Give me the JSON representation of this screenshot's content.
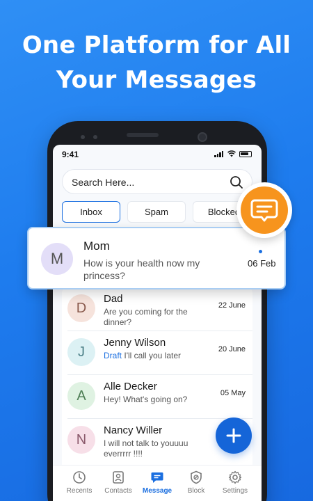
{
  "headline": {
    "line1": "One Platform for All",
    "line2": "Your Messages"
  },
  "status_bar": {
    "time": "9:41"
  },
  "search": {
    "placeholder": "Search Here..."
  },
  "tabs": [
    {
      "label": "Inbox",
      "active": true
    },
    {
      "label": "Spam",
      "active": false
    },
    {
      "label": "Blocked",
      "active": false
    }
  ],
  "highlighted_message": {
    "initial": "M",
    "name": "Mom",
    "preview": "How is your health now my princess?",
    "date": "06 Feb",
    "unread": true
  },
  "messages": [
    {
      "initial": "D",
      "name": "Dad",
      "draft_label": "",
      "preview": "Are you coming for the dinner?",
      "date": "22 June",
      "avatar_bg": "#f6e3dc"
    },
    {
      "initial": "J",
      "name": "Jenny Wilson",
      "draft_label": "Draft",
      "preview": "I'll call you later",
      "date": "20 June",
      "avatar_bg": "#dcf1f4"
    },
    {
      "initial": "A",
      "name": "Alle Decker",
      "draft_label": "",
      "preview": "Hey! What's going on?",
      "date": "05 May",
      "avatar_bg": "#dff2e2"
    },
    {
      "initial": "N",
      "name": "Nancy Willer",
      "draft_label": "",
      "preview": "I will not talk to youuuu everrrrr !!!!",
      "date": "",
      "avatar_bg": "#f7dfe8"
    }
  ],
  "bottom_nav": [
    {
      "label": "Recents",
      "icon": "clock-icon",
      "active": false
    },
    {
      "label": "Contacts",
      "icon": "contacts-icon",
      "active": false
    },
    {
      "label": "Message",
      "icon": "message-icon",
      "active": true
    },
    {
      "label": "Block",
      "icon": "shield-block-icon",
      "active": false
    },
    {
      "label": "Settings",
      "icon": "gear-icon",
      "active": false
    }
  ],
  "colors": {
    "accent": "#1b6fe0",
    "badge": "#f7941d",
    "background": "#1e7cee"
  }
}
